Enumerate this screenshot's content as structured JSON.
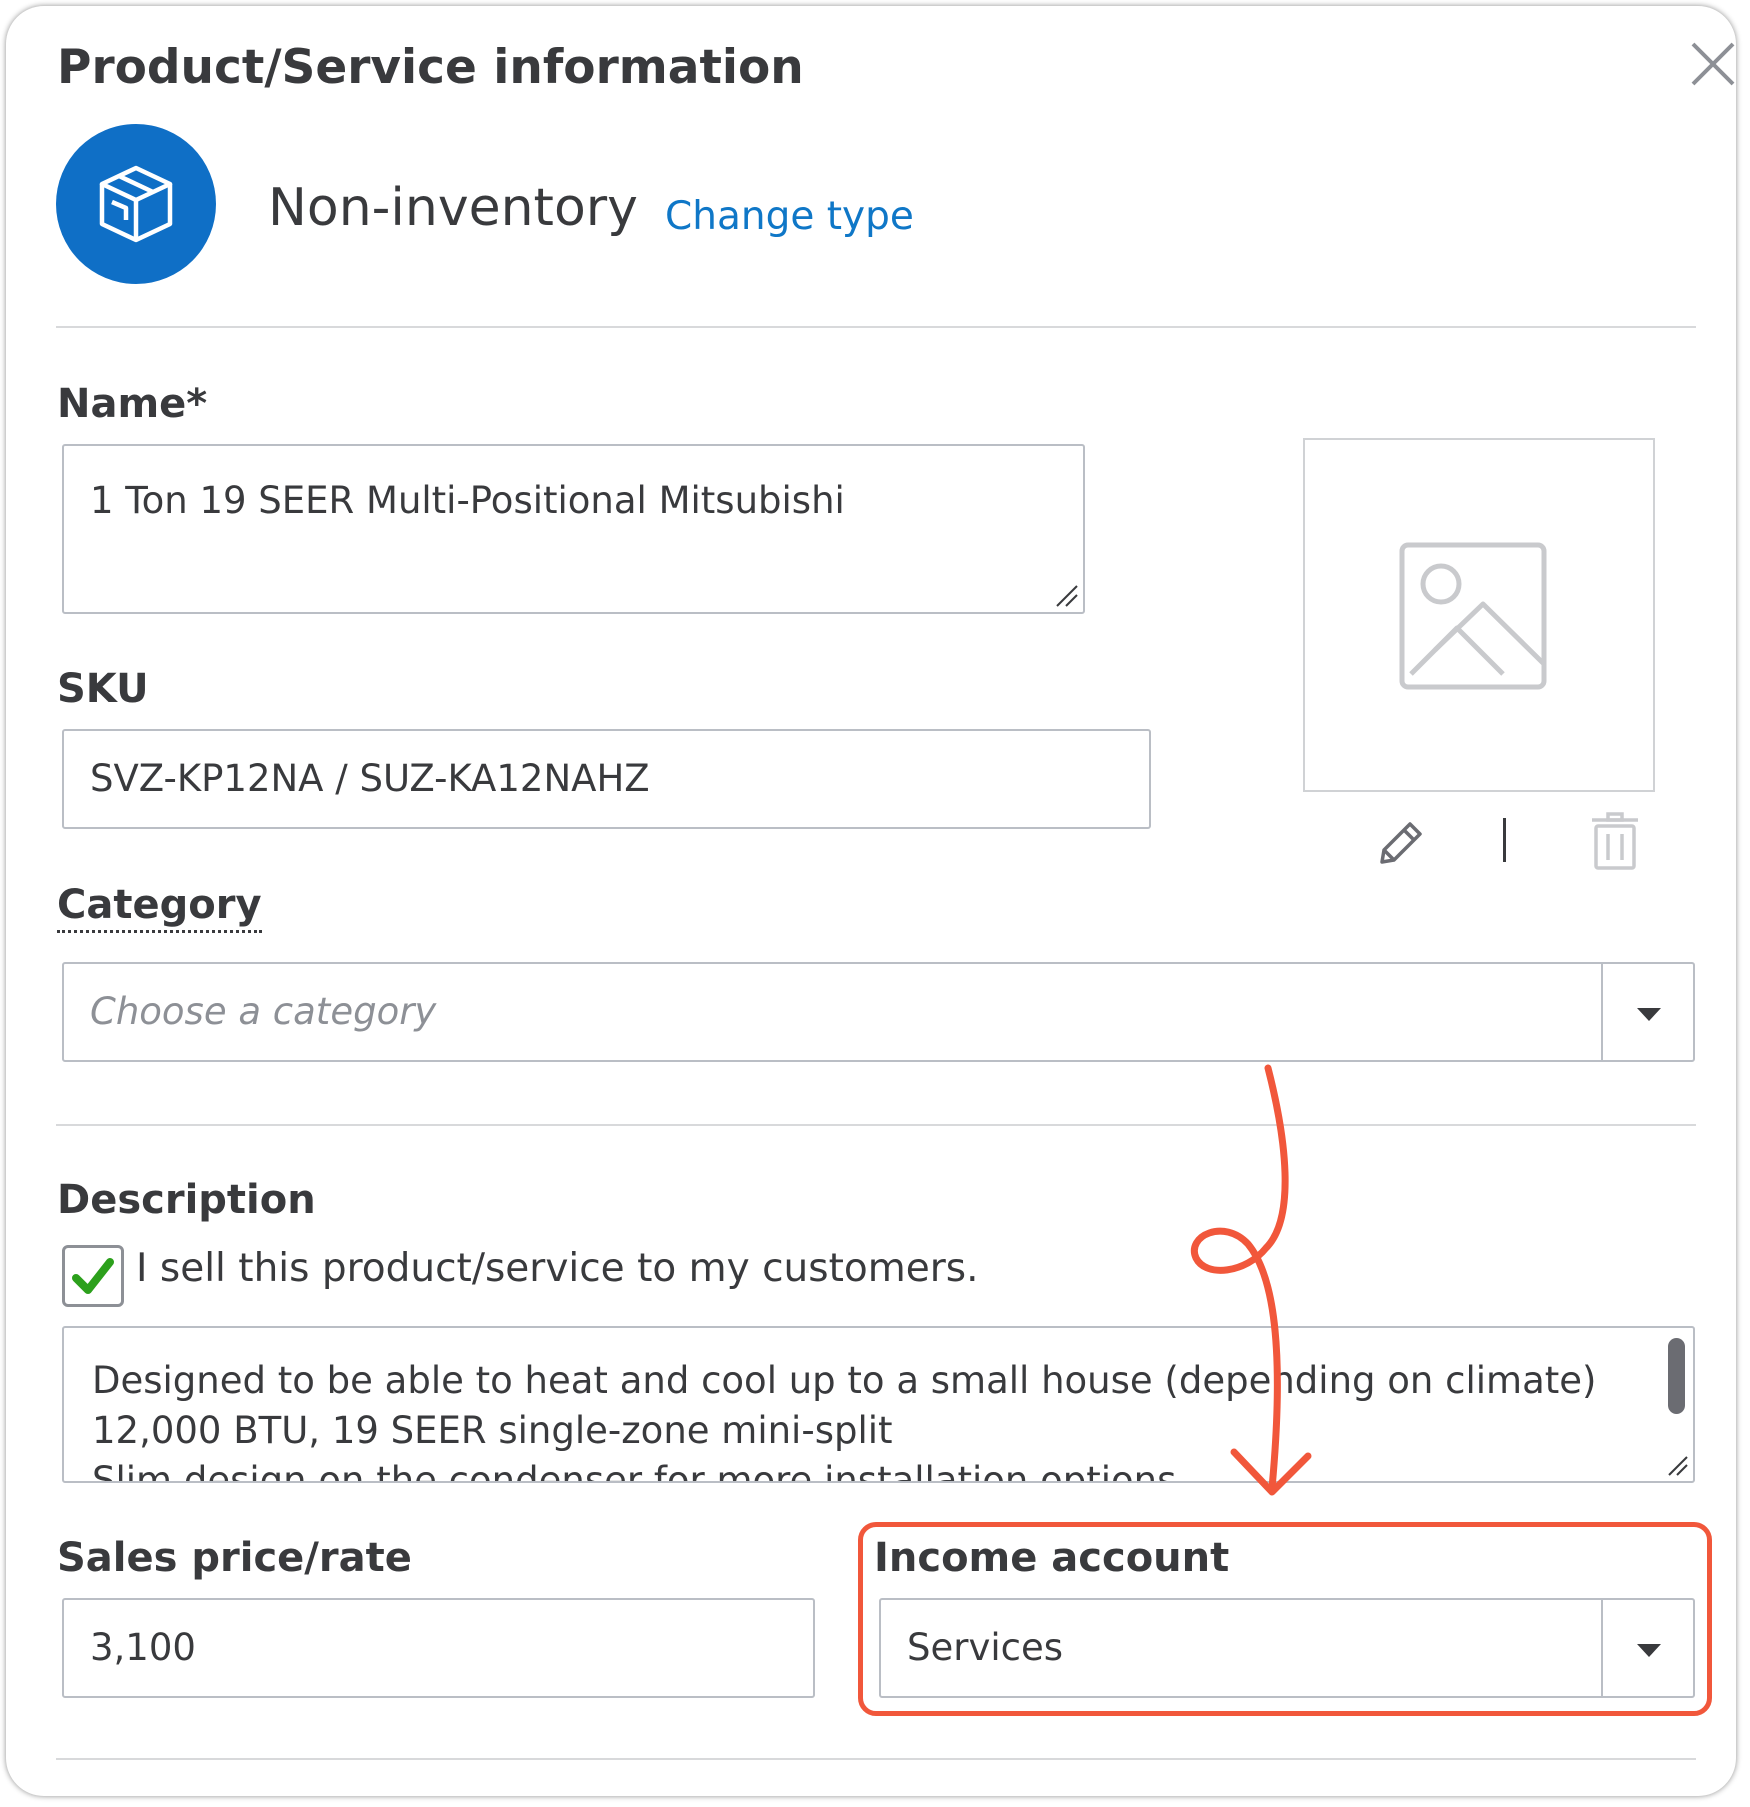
{
  "dialog": {
    "title": "Product/Service information",
    "item_type": "Non-inventory",
    "change_type_label": "Change type"
  },
  "form": {
    "name": {
      "label": "Name*",
      "value": "1 Ton 19 SEER Multi-Positional Mitsubishi"
    },
    "sku": {
      "label": "SKU",
      "value": "SVZ-KP12NA / SUZ-KA12NAHZ"
    },
    "category": {
      "label": "Category",
      "placeholder": "Choose a category"
    },
    "description": {
      "label": "Description",
      "sell_checkbox_label": "I sell this product/service to my customers.",
      "sell_checked": true,
      "lines": [
        "Designed to be able to heat and cool up to a small house (depending on climate)",
        "12,000 BTU, 19 SEER single-zone mini-split",
        "Slim design on the condenser for more installation options"
      ]
    },
    "sales_price": {
      "label": "Sales price/rate",
      "value": "3,100"
    },
    "income_account": {
      "label": "Income account",
      "value": "Services"
    }
  },
  "icons": {
    "close": "close-icon",
    "type": "box-icon",
    "image_placeholder": "image-placeholder-icon",
    "edit": "pencil-icon",
    "delete": "trash-icon",
    "dropdown": "chevron-down-icon",
    "check": "checkmark-icon"
  },
  "colors": {
    "brand_blue": "#0f6fc6",
    "link_blue": "#0f77c7",
    "check_green": "#2ca01c",
    "annotation_red": "#f1573b"
  }
}
